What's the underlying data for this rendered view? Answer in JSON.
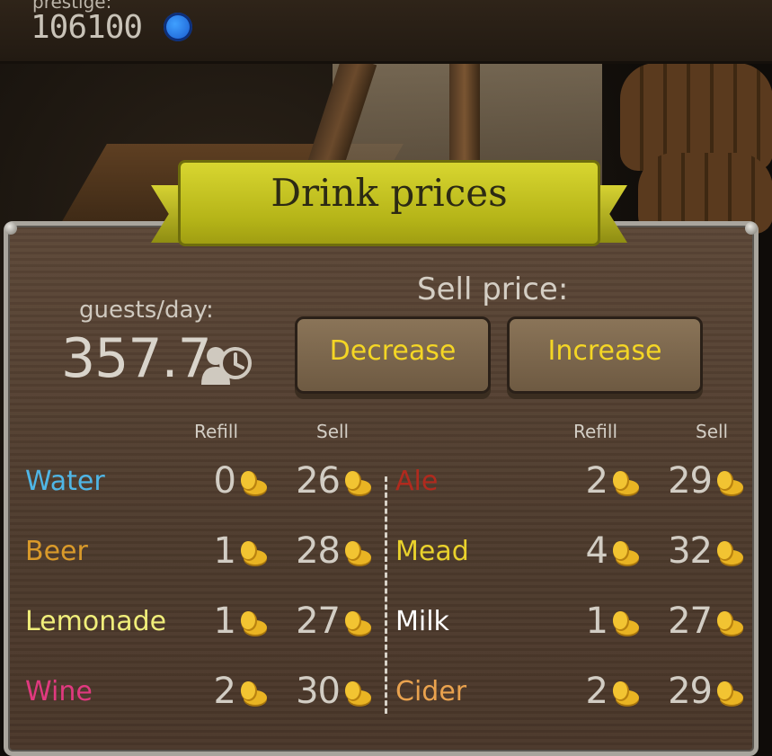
{
  "top_bar": {
    "prestige_label": "prestige:",
    "prestige_value": "106100",
    "prestige_icon": "blue-badge-icon"
  },
  "panel": {
    "title": "Drink prices",
    "guests_label": "guests/day:",
    "guests_value": "357.7",
    "guests_icon": "guests-per-day-clock-icon",
    "sell_price_label": "Sell price:",
    "decrease_label": "Decrease",
    "increase_label": "Increase",
    "columns": {
      "left_refill": "Refill",
      "left_sell": "Sell",
      "right_refill": "Refill",
      "right_sell": "Sell"
    },
    "drinks_left": [
      {
        "name": "Water",
        "color": "#4fb6e6",
        "refill": "0",
        "sell": "26"
      },
      {
        "name": "Beer",
        "color": "#d99a2a",
        "refill": "1",
        "sell": "28"
      },
      {
        "name": "Lemonade",
        "color": "#f0ee7a",
        "refill": "1",
        "sell": "27"
      },
      {
        "name": "Wine",
        "color": "#e0397f",
        "refill": "2",
        "sell": "30"
      }
    ],
    "drinks_right": [
      {
        "name": "Ale",
        "color": "#b02a1e",
        "refill": "2",
        "sell": "29"
      },
      {
        "name": "Mead",
        "color": "#e9d12c",
        "refill": "4",
        "sell": "32"
      },
      {
        "name": "Milk",
        "color": "#ffffff",
        "refill": "1",
        "sell": "27"
      },
      {
        "name": "Cider",
        "color": "#e9a24e",
        "refill": "2",
        "sell": "29"
      }
    ],
    "coin_icon": "gold-coins-icon"
  }
}
